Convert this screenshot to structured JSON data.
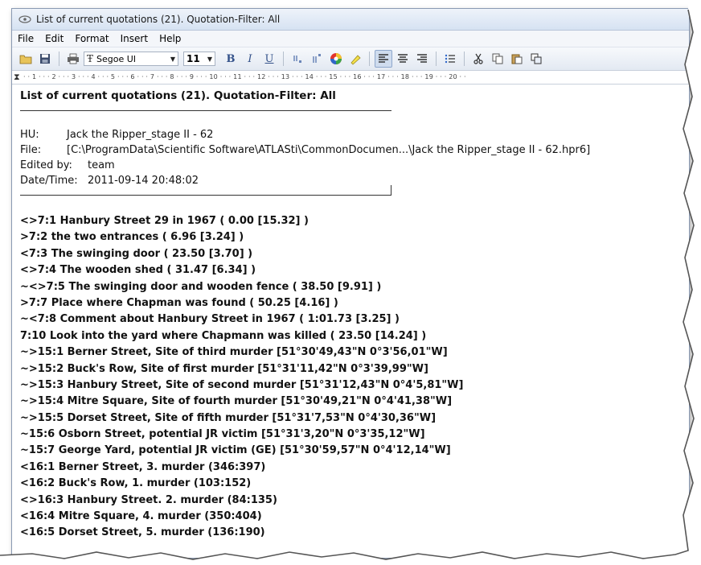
{
  "window": {
    "title": "List of current quotations (21). Quotation-Filter: All",
    "title_icon": "atlas-ti-icon"
  },
  "menu": [
    "File",
    "Edit",
    "Format",
    "Insert",
    "Help"
  ],
  "toolbar": {
    "font_name": "Segoe UI",
    "font_size": "11",
    "icons": [
      "open-icon",
      "save-icon",
      "print-icon",
      "font-icon",
      "bold-icon",
      "italic-icon",
      "underline-icon",
      "subscript-icon",
      "superscript-icon",
      "color-icon",
      "highlight-icon",
      "align-left-icon",
      "align-center-icon",
      "align-right-icon",
      "bullets-icon",
      "cut-icon",
      "copy-icon",
      "paste-icon",
      "insert-object-icon"
    ],
    "bold_label": "B",
    "italic_label": "I",
    "underline_label": "U"
  },
  "ruler": {
    "text": "· · 1 · · · 2 · · · 3 · · · 4 · · · 5 · · · 6 · · · 7 · · · 8 · · · 9 · · · 10 · · · 11 · · · 12 · · · 13 · · · 14 · · · 15 · · · 16 · · · 17 · · · 18 · · · 19 · · · 20 · ·"
  },
  "document": {
    "heading": "List of current quotations (21). Quotation-Filter: All",
    "meta": {
      "hu_label": "HU:",
      "hu_value": "Jack the Ripper_stage II - 62",
      "file_label": "File:",
      "file_value": "[C:\\ProgramData\\Scientific Software\\ATLASti\\CommonDocumen...\\Jack the Ripper_stage II - 62.hpr6]",
      "edited_label": "Edited by:",
      "edited_value": "team",
      "date_label": "Date/Time:",
      "date_value": "2011-09-14 20:48:02"
    },
    "quotations": [
      "<>7:1 Hanbury Street 29 in 1967 ( 0.00 [15.32] )",
      ">7:2 the two entrances ( 6.96 [3.24] )",
      "<7:3 The swinging door ( 23.50 [3.70] )",
      "<>7:4 The wooden shed ( 31.47 [6.34] )",
      "~<>7:5 The swinging door and wooden fence ( 38.50 [9.91] )",
      ">7:7 Place where Chapman was found ( 50.25 [4.16] )",
      "~<7:8 Comment about Hanbury Street in 1967 ( 1:01.73 [3.25] )",
      "7:10 Look into the yard where Chapmann was killed ( 23.50 [14.24] )",
      "~>15:1 Berner Street, Site of third murder [51°30'49,43\"N 0°3'56,01\"W]",
      "~>15:2 Buck's Row, Site of first murder [51°31'11,42\"N 0°3'39,99\"W]",
      "~>15:3 Hanbury Street, Site of second murder [51°31'12,43\"N 0°4'5,81\"W]",
      "~>15:4 Mitre Square, Site of fourth murder [51°30'49,21\"N 0°4'41,38\"W]",
      "~>15:5 Dorset Street, Site of fifth murder [51°31'7,53\"N 0°4'30,36\"W]",
      "~15:6 Osborn Street, potential JR victim [51°31'3,20\"N 0°3'35,12\"W]",
      "~15:7 George Yard, potential JR victim (GE) [51°30'59,57\"N 0°4'12,14\"W]",
      "<16:1 Berner Street, 3. murder (346:397)",
      "<16:2 Buck's Row, 1. murder (103:152)",
      "<>16:3 Hanbury Street. 2. murder (84:135)",
      "<16:4 Mitre Square, 4. murder (350:404)",
      "<16:5 Dorset Street, 5. murder (136:190)"
    ]
  }
}
